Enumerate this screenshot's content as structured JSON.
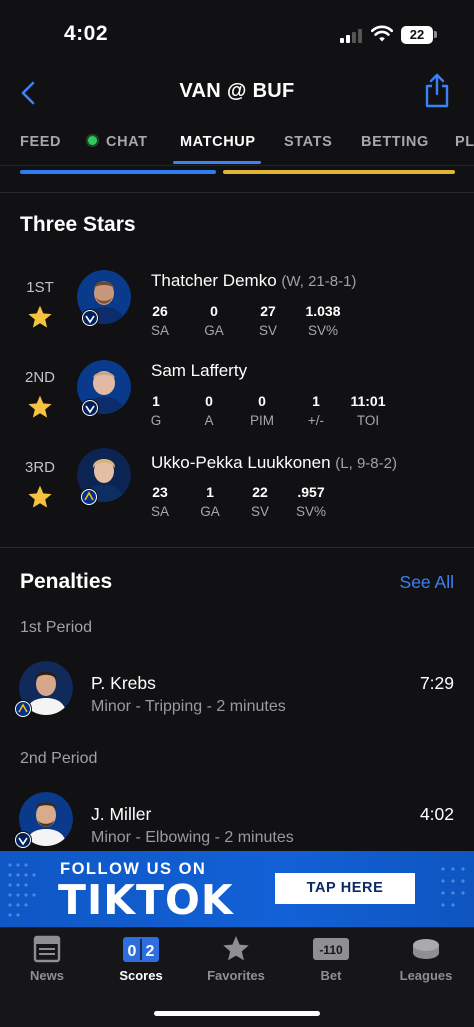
{
  "status_bar": {
    "time": "4:02",
    "battery": "22"
  },
  "header": {
    "title": "VAN @ BUF"
  },
  "tabs": [
    {
      "label": "FEED"
    },
    {
      "label": "CHAT"
    },
    {
      "label": "MATCHUP"
    },
    {
      "label": "STATS"
    },
    {
      "label": "BETTING"
    },
    {
      "label": "PL"
    }
  ],
  "active_tab": "MATCHUP",
  "colors": {
    "van": "#2f7df4",
    "buf": "#e0b437",
    "accent": "#3a82f7",
    "star": "#f5c242"
  },
  "three_stars": {
    "title": "Three Stars",
    "players": [
      {
        "rank": "1ST",
        "name": "Thatcher Demko",
        "record": "(W, 21-8-1)",
        "team": "VAN",
        "stats": [
          {
            "value": "26",
            "label": "SA"
          },
          {
            "value": "0",
            "label": "GA"
          },
          {
            "value": "27",
            "label": "SV"
          },
          {
            "value": "1.038",
            "label": "SV%"
          }
        ]
      },
      {
        "rank": "2ND",
        "name": "Sam Lafferty",
        "record": "",
        "team": "VAN",
        "stats": [
          {
            "value": "1",
            "label": "G"
          },
          {
            "value": "0",
            "label": "A"
          },
          {
            "value": "0",
            "label": "PIM"
          },
          {
            "value": "1",
            "label": "+/-"
          },
          {
            "value": "11:01",
            "label": "TOI"
          }
        ]
      },
      {
        "rank": "3RD",
        "name": "Ukko-Pekka Luukkonen",
        "record": "(L, 9-8-2)",
        "team": "BUF",
        "stats": [
          {
            "value": "23",
            "label": "SA"
          },
          {
            "value": "1",
            "label": "GA"
          },
          {
            "value": "22",
            "label": "SV"
          },
          {
            "value": ".957",
            "label": "SV%"
          }
        ]
      }
    ]
  },
  "penalties": {
    "title": "Penalties",
    "see_all": "See All",
    "periods": [
      {
        "label": "1st Period",
        "items": [
          {
            "player": "P. Krebs",
            "description": "Minor - Tripping - 2 minutes",
            "time": "7:29",
            "team": "BUF"
          }
        ]
      },
      {
        "label": "2nd Period",
        "items": [
          {
            "player": "J. Miller",
            "description": "Minor - Elbowing - 2 minutes",
            "time": "4:02",
            "team": "VAN"
          }
        ]
      }
    ]
  },
  "banner": {
    "line1": "FOLLOW US ON",
    "line2": "TIKTOK",
    "button": "TAP HERE"
  },
  "bottom_nav": [
    {
      "label": "News",
      "icon": "news-icon"
    },
    {
      "label": "Scores",
      "icon": "scores-icon",
      "badge": [
        "0",
        "2"
      ]
    },
    {
      "label": "Favorites",
      "icon": "star-icon"
    },
    {
      "label": "Bet",
      "icon": "bet-icon",
      "badge_text": "-110"
    },
    {
      "label": "Leagues",
      "icon": "puck-icon"
    }
  ]
}
